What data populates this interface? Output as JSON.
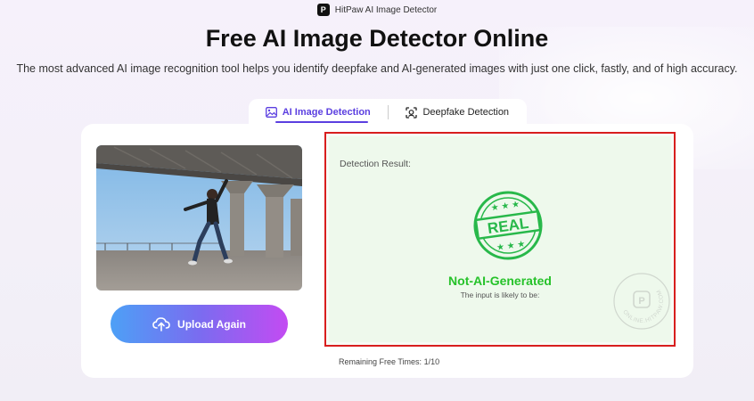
{
  "brand": {
    "name": "HitPaw AI Image Detector",
    "logo_letter": "P"
  },
  "headline": "Free AI Image Detector Online",
  "subheadline": "The most advanced AI image recognition tool helps you identify deepfake and AI-generated images with just one click, fastly, and of high accuracy.",
  "tabs": [
    {
      "label": "AI Image Detection",
      "icon": "image-icon",
      "active": true
    },
    {
      "label": "Deepfake Detection",
      "icon": "face-scan-icon",
      "active": false
    }
  ],
  "upload": {
    "label": "Upload Again",
    "icon": "upload-cloud-icon"
  },
  "result": {
    "label": "Detection Result:",
    "stamp_text": "REAL",
    "verdict": "Not-AI-Generated",
    "verdict_sub": "The input is likely to be:",
    "watermark_text": "ONLINE.HITPAW.COM"
  },
  "remaining": {
    "label": "Remaining Free Times:",
    "value": "1/10"
  },
  "colors": {
    "accent": "#5b3fe0",
    "verdict": "#26c22a",
    "highlight_border": "#d81e1e"
  }
}
